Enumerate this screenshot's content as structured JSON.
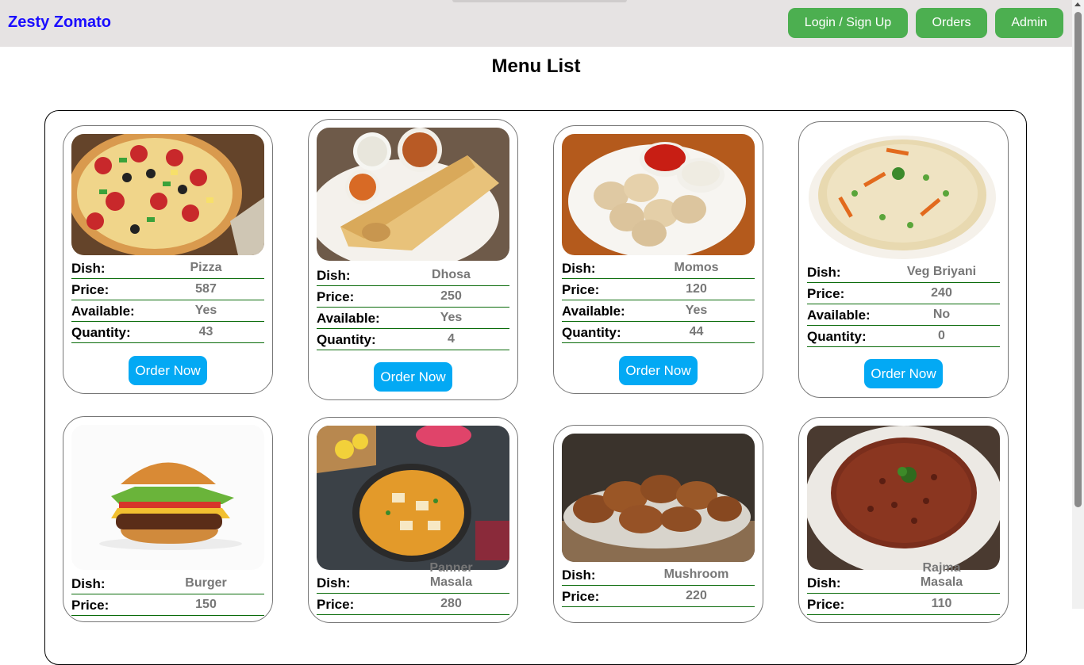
{
  "brand": "Zesty Zomato",
  "nav": {
    "login": "Login / Sign Up",
    "orders": "Orders",
    "admin": "Admin"
  },
  "page_title": "Menu List",
  "labels": {
    "dish": "Dish:",
    "price": "Price:",
    "available": "Available:",
    "quantity": "Quantity:"
  },
  "order_label": "Order Now",
  "dishes": [
    {
      "name": "Pizza",
      "price": "587",
      "available": "Yes",
      "quantity": "43",
      "image": "pizza-image"
    },
    {
      "name": "Dhosa",
      "price": "250",
      "available": "Yes",
      "quantity": "4",
      "image": "dosa-image"
    },
    {
      "name": "Momos",
      "price": "120",
      "available": "Yes",
      "quantity": "44",
      "image": "momos-image"
    },
    {
      "name": "Veg Briyani",
      "price": "240",
      "available": "No",
      "quantity": "0",
      "image": "biryani-image"
    },
    {
      "name": "Burger",
      "price": "150",
      "image": "burger-image"
    },
    {
      "name": "Panner Masala",
      "price": "280",
      "image": "paneer-masala-image"
    },
    {
      "name": "Mushroom",
      "price": "220",
      "image": "mushroom-image"
    },
    {
      "name": "Rajma Masala",
      "price": "110",
      "image": "rajma-masala-image"
    }
  ],
  "colors": {
    "navbar": "#e6e3e3",
    "brand": "#1a0dff",
    "nav_button": "#4caf50",
    "order_button": "#03a9f4",
    "row_line": "#0a6b0a"
  }
}
